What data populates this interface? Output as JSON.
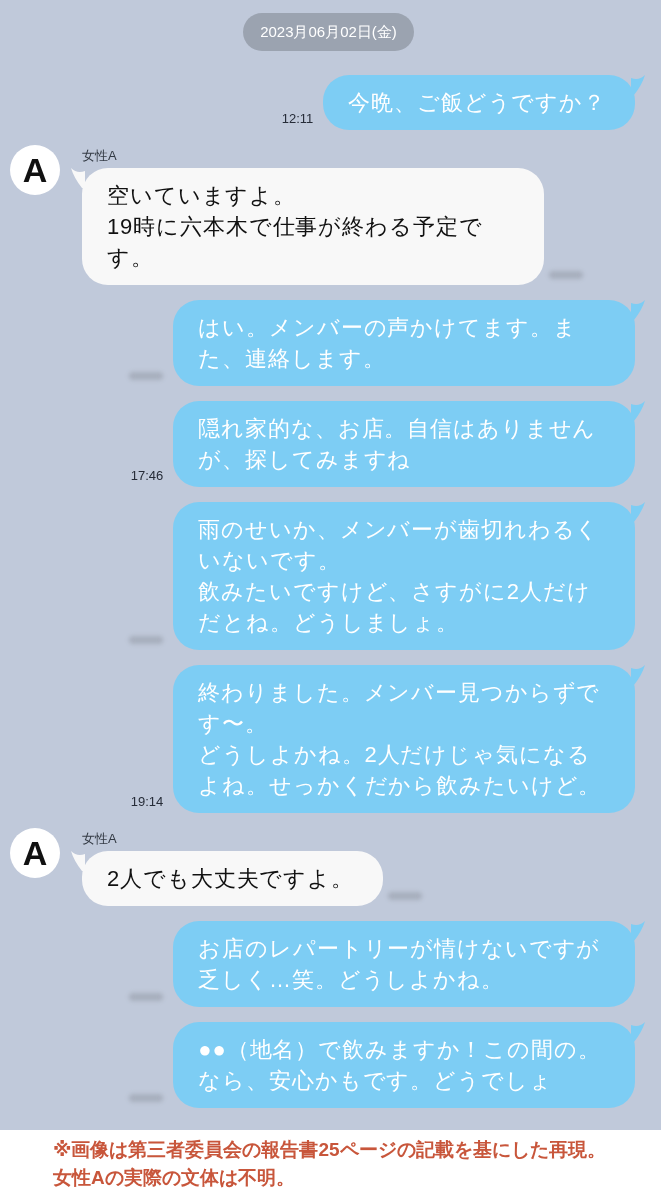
{
  "date_chip": "2023月06月02日(金)",
  "messages": [
    {
      "kind": "sent",
      "paragraphs": [
        "今晩、ご飯どうですか？"
      ],
      "time": "12:11",
      "time_blurred": false
    },
    {
      "kind": "received",
      "name": "女性A",
      "avatar": "A",
      "paragraphs": [
        "空いていますよ。",
        "19時に六本木で仕事が終わる予定です。"
      ],
      "time_blurred": true
    },
    {
      "kind": "sent",
      "paragraphs": [
        "はい。メンバーの声かけてます。また、連絡します。"
      ],
      "time_blurred": true
    },
    {
      "kind": "sent",
      "paragraphs": [
        "隠れ家的な、お店。自信はありませんが、探してみますね"
      ],
      "time": "17:46",
      "time_blurred": false
    },
    {
      "kind": "sent",
      "paragraphs": [
        "雨のせいか、メンバーが歯切れわるくいないです。",
        "飲みたいですけど、さすがに2人だけだとね。どうしましょ。"
      ],
      "time_blurred": true
    },
    {
      "kind": "sent",
      "paragraphs": [
        "終わりました。メンバー見つからずです〜。",
        "どうしよかね。2人だけじゃ気になるよね。せっかくだから飲みたいけど。"
      ],
      "time": "19:14",
      "time_blurred": false
    },
    {
      "kind": "received",
      "name": "女性A",
      "avatar": "A",
      "paragraphs": [
        "2人でも大丈夫ですよ。"
      ],
      "time_blurred": true
    },
    {
      "kind": "sent",
      "paragraphs": [
        "お店のレパートリーが情けないですが乏しく…笑。どうしよかね。"
      ],
      "time_blurred": true
    },
    {
      "kind": "sent",
      "paragraphs": [
        "●●（地名）で飲みますか！この間の。なら、安心かもです。どうでしょ"
      ],
      "time_blurred": true
    }
  ],
  "footnote": [
    "※画像は第三者委員会の報告書25ページの記載を基にした再現。",
    "女性Aの実際の文体は不明。"
  ]
}
